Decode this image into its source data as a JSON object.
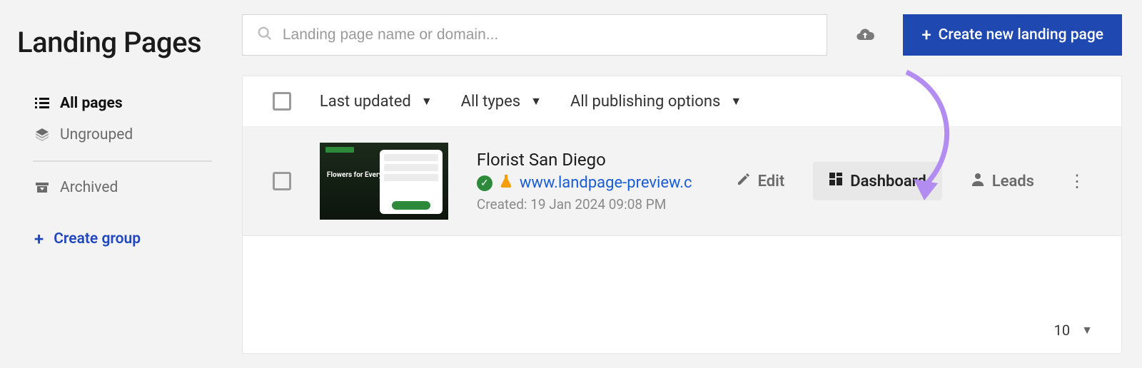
{
  "header": {
    "title": "Landing Pages",
    "search_placeholder": "Landing page name or domain...",
    "create_label": "Create new landing page"
  },
  "sidebar": {
    "items": [
      {
        "label": "All pages",
        "icon": "list-icon",
        "active": true
      },
      {
        "label": "Ungrouped",
        "icon": "stack-icon",
        "active": false
      }
    ],
    "archived_label": "Archived",
    "create_group_label": "Create group"
  },
  "filters": {
    "sort": "Last updated",
    "types": "All types",
    "publishing": "All publishing options"
  },
  "row": {
    "thumb_text": "Flowers for Every Occasion!",
    "title": "Florist San Diego",
    "url": "www.landpage-preview.c",
    "created_label": "Created: 19 Jan 2024 09:08 PM"
  },
  "actions": {
    "edit": "Edit",
    "dashboard": "Dashboard",
    "leads": "Leads"
  },
  "footer": {
    "page_size": "10"
  }
}
